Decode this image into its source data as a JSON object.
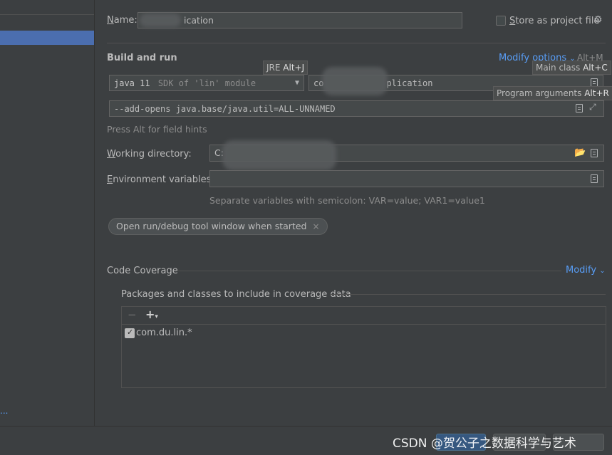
{
  "sidebar": {
    "more_label": "..."
  },
  "name_row": {
    "label": "Name:",
    "value_suffix": "ication",
    "store_label": "Store as project file"
  },
  "build_run": {
    "title": "Build and run",
    "modify_options": "Modify options",
    "modify_shortcut": "Alt+M",
    "jre_tooltip": {
      "text": "JRE ",
      "key": "Alt+J"
    },
    "main_class_tooltip": {
      "text": "Main class ",
      "key": "Alt+C"
    },
    "program_args_tooltip": {
      "text": "Program arguments ",
      "key": "Alt+R"
    },
    "sdk_value": "java 11",
    "sdk_detail": "SDK of 'lin' module",
    "main_class_prefix": "co",
    "main_class_suffix": "plication",
    "vm_options": "--add-opens java.base/java.util=ALL-UNNAMED",
    "field_hint": "Press Alt for field hints"
  },
  "working_dir": {
    "label": "Working directory:",
    "value_prefix": "C:"
  },
  "env_vars": {
    "label": "Environment variables:",
    "value": "",
    "hint": "Separate variables with semicolon: VAR=value; VAR1=value1"
  },
  "chip": {
    "label": "Open run/debug tool window when started",
    "close": "×"
  },
  "coverage": {
    "title": "Code Coverage",
    "modify": "Modify",
    "packages_title": "Packages and classes to include in coverage data",
    "remove_icon": "−",
    "add_icon": "+",
    "items": [
      {
        "label": "com.du.lin.*",
        "checked": true
      }
    ]
  },
  "watermark": "CSDN @贺公子之数据科学与艺术"
}
